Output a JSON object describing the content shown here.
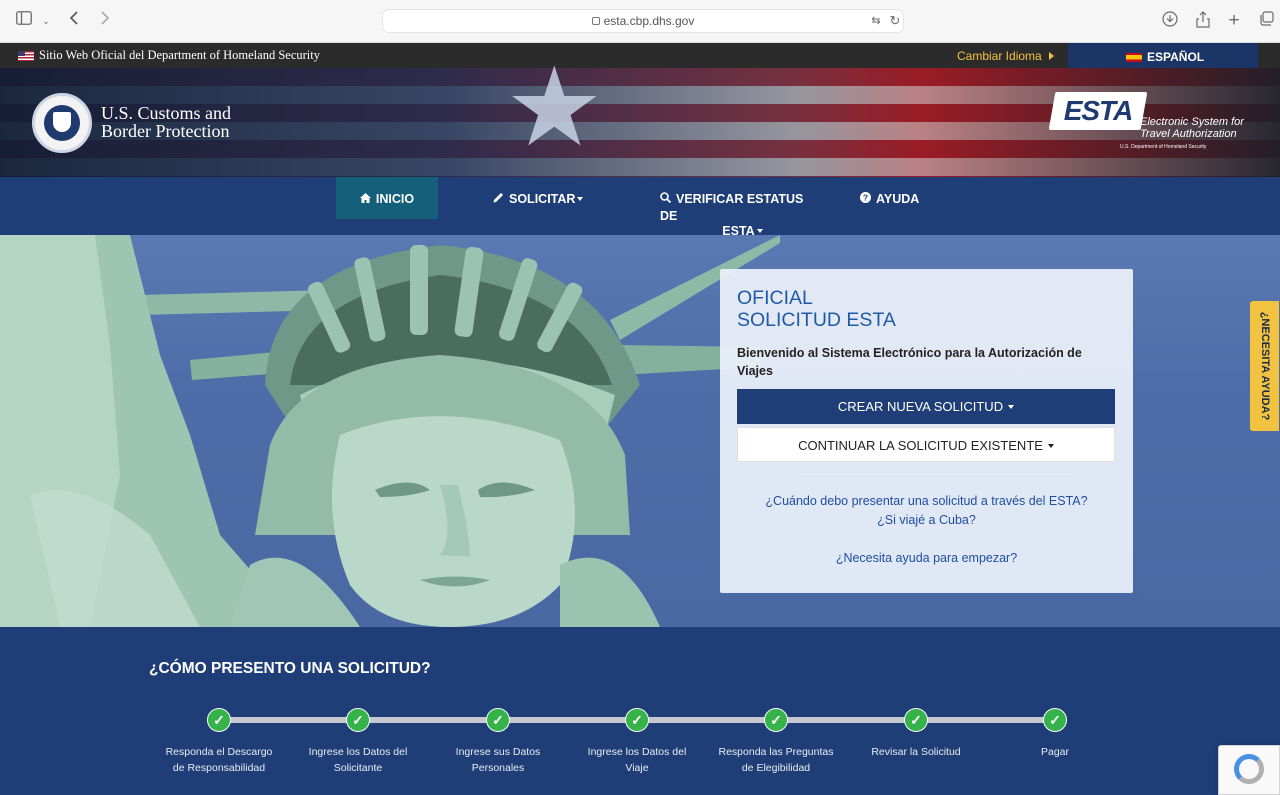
{
  "browser": {
    "url": "esta.cbp.dhs.gov"
  },
  "gov_banner": {
    "text": "Sitio Web Oficial del Department of Homeland Security",
    "change_language": "Cambiar Idioma",
    "language": "ESPAÑOL"
  },
  "header": {
    "agency_name_line1": "U.S. Customs and",
    "agency_name_line2": "Border Protection",
    "esta_logo": "ESTA",
    "esta_subtitle_line1": "Electronic System for",
    "esta_subtitle_line2": "Travel Authorization",
    "esta_dept": "U.S. Department of Homeland Security"
  },
  "nav": {
    "items": [
      {
        "label": "INICIO",
        "icon": "home-icon"
      },
      {
        "label": "SOLICITAR",
        "icon": "pencil-icon"
      },
      {
        "label_line1": "VERIFICAR ESTATUS DE",
        "label_line2": "ESTA",
        "icon": "search-icon"
      },
      {
        "label": "AYUDA",
        "icon": "question-circle-icon"
      }
    ]
  },
  "card": {
    "title_line1": "OFICIAL",
    "title_line2": "SOLICITUD ESTA",
    "welcome": "Bienvenido al Sistema Electrónico para la Autorización de Viajes",
    "create_button": "CREAR NUEVA SOLICITUD",
    "continue_button": "CONTINUAR LA SOLICITUD EXISTENTE",
    "link_when": "¿Cuándo debo presentar una solicitud a través del ESTA?",
    "link_cuba": "¿Si viajé a Cuba?",
    "link_help": "¿Necesita ayuda para empezar?"
  },
  "help_tab": "¿NECESITA AYUDA?",
  "steps": {
    "title": "¿CÓMO PRESENTO UNA SOLICITUD?",
    "items": [
      {
        "line1": "Responda el Descargo",
        "line2": "de Responsabilidad"
      },
      {
        "line1": "Ingrese los Datos del",
        "line2": "Solicitante"
      },
      {
        "line1": "Ingrese sus Datos",
        "line2": "Personales"
      },
      {
        "line1": "Ingrese los Datos del",
        "line2": "Viaje"
      },
      {
        "line1": "Responda las Preguntas",
        "line2": "de Elegibilidad"
      },
      {
        "line1": "Revisar la Solicitud",
        "line2": ""
      },
      {
        "line1": "Pagar",
        "line2": ""
      }
    ]
  },
  "colors": {
    "nav_blue": "#1f3e78",
    "nav_active": "#14607a",
    "accent_yellow": "#f2c241",
    "link_blue": "#1f4fa0",
    "check_green": "#36b24a"
  }
}
